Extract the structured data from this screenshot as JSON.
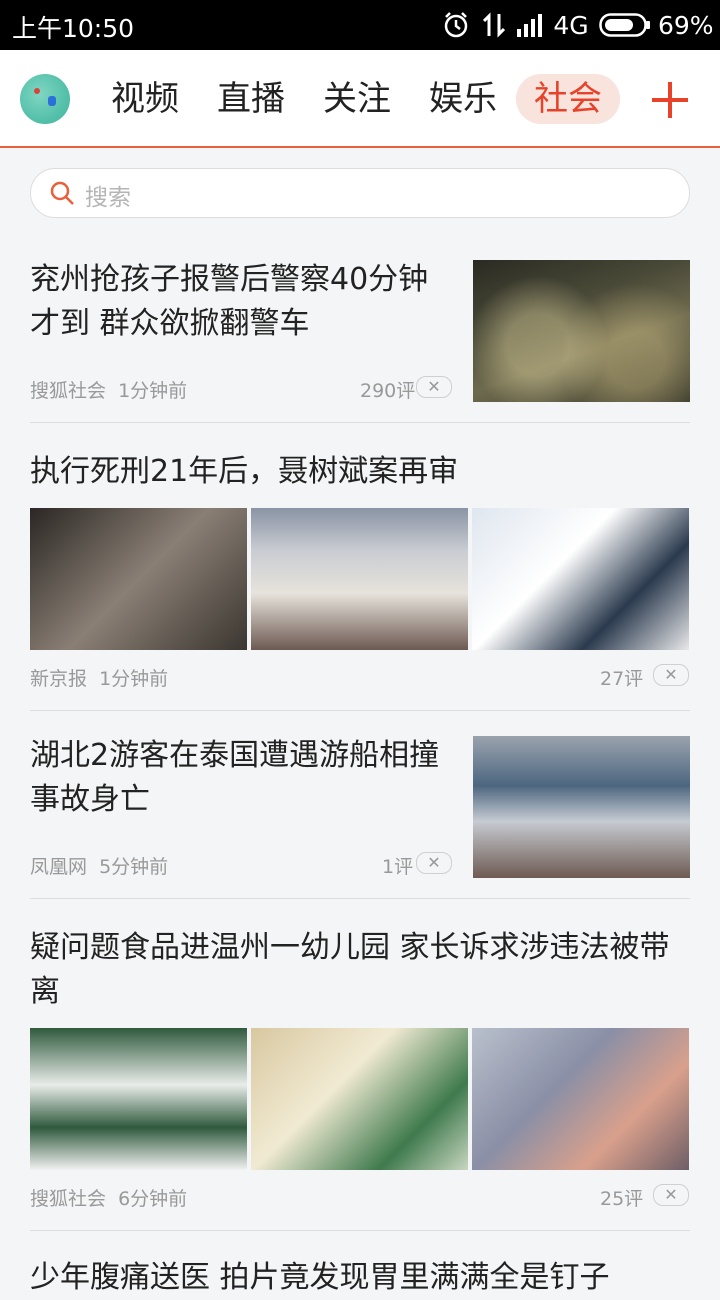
{
  "status_bar": {
    "time": "上午10:50",
    "network": "4G",
    "battery": "69%"
  },
  "nav": {
    "tabs": [
      "视频",
      "直播",
      "关注",
      "娱乐",
      "社会"
    ],
    "active_tab": "社会"
  },
  "search": {
    "placeholder": "搜索"
  },
  "news": [
    {
      "title": "兖州抢孩子报警后警察40分钟才到 群众欲掀翻警车",
      "source": "搜狐社会",
      "time": "1分钟前",
      "comments": "290评"
    },
    {
      "title": "执行死刑21年后，聂树斌案再审",
      "source": "新京报",
      "time": "1分钟前",
      "comments": "27评"
    },
    {
      "title": "湖北2游客在泰国遭遇游船相撞事故身亡",
      "source": "凤凰网",
      "time": "5分钟前",
      "comments": "1评"
    },
    {
      "title": "疑问题食品进温州一幼儿园 家长诉求涉违法被带离",
      "source": "搜狐社会",
      "time": "6分钟前",
      "comments": "25评"
    },
    {
      "title": "少年腹痛送医 拍片竟发现胃里满满全是钉子"
    }
  ],
  "dismiss_label": "✕"
}
